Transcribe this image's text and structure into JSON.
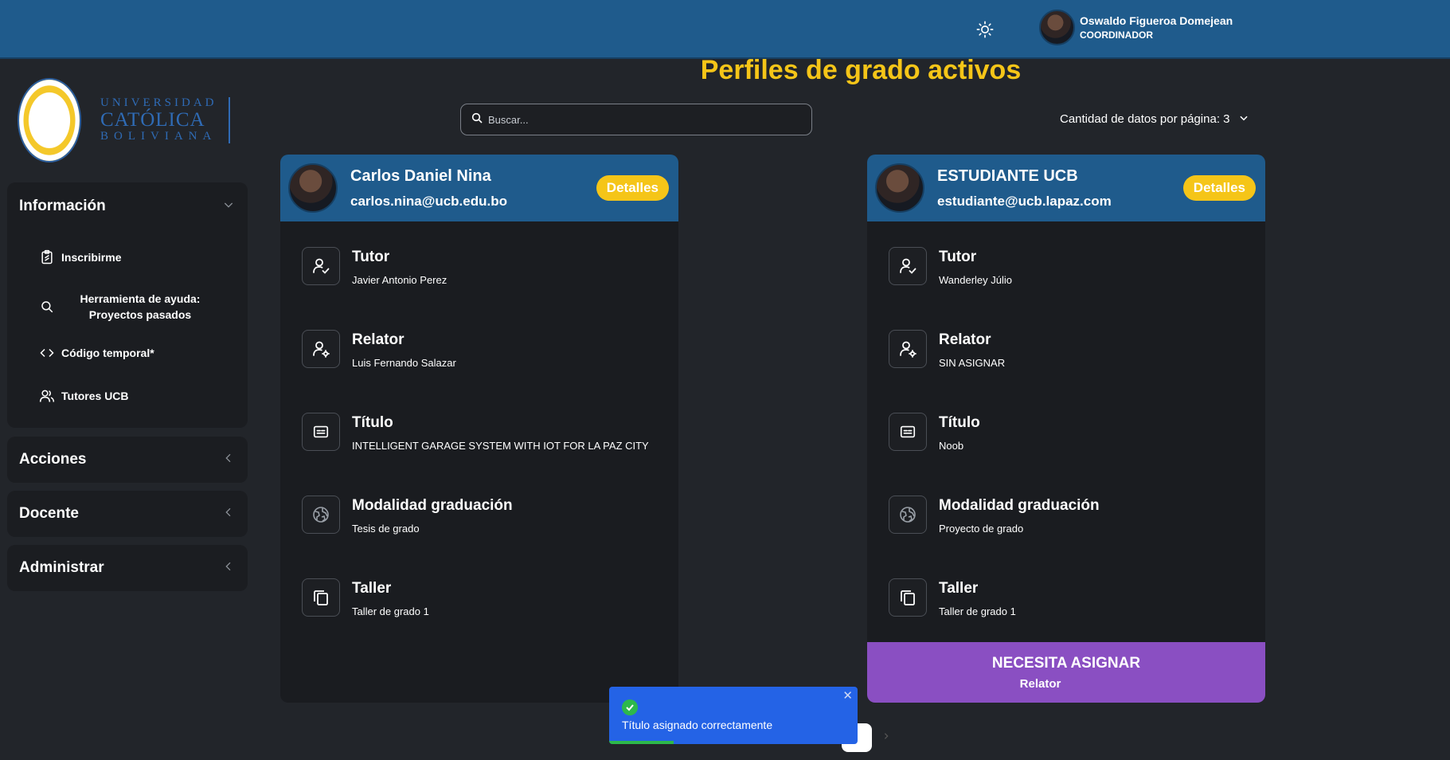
{
  "header": {
    "theme_icon": "sun-icon",
    "user_name": "Oswaldo Figueroa Domejean",
    "user_role": "COORDINADOR"
  },
  "logo": {
    "line1": "UNIVERSIDAD",
    "line2": "CATÓLICA",
    "line3": "BOLIVIANA"
  },
  "sidebar": {
    "informacion": {
      "label": "Información",
      "items": [
        {
          "label": "Inscribirme",
          "icon": "clipboard-icon"
        },
        {
          "label": "Herramienta de ayuda: Proyectos pasados",
          "icon": "search-icon"
        },
        {
          "label": "Código temporal*",
          "icon": "code-icon"
        },
        {
          "label": "Tutores UCB",
          "icon": "users-icon"
        }
      ]
    },
    "acciones": "Acciones",
    "docente": "Docente",
    "administrar": "Administrar"
  },
  "main": {
    "title": "Perfiles de grado activos",
    "search_placeholder": "Buscar...",
    "page_size_label": "Cantidad de datos por página: 3"
  },
  "cards": [
    {
      "name": "Carlos Daniel Nina",
      "email": "carlos.nina@ucb.edu.bo",
      "details_label": "Detalles",
      "fields": [
        {
          "label": "Tutor",
          "value": "Javier Antonio Perez",
          "icon": "user-check-icon"
        },
        {
          "label": "Relator",
          "value": "Luis Fernando Salazar",
          "icon": "user-gear-icon"
        },
        {
          "label": "Título",
          "value": "INTELLIGENT GARAGE SYSTEM WITH IOT FOR LA PAZ CITY",
          "icon": "title-card-icon"
        },
        {
          "label": "Modalidad graduación",
          "value": "Tesis de grado",
          "icon": "globe-icon"
        },
        {
          "label": "Taller",
          "value": "Taller de grado 1",
          "icon": "copy-icon"
        }
      ]
    },
    {
      "name": "ESTUDIANTE UCB",
      "email": "estudiante@ucb.lapaz.com",
      "details_label": "Detalles",
      "fields": [
        {
          "label": "Tutor",
          "value": "Wanderley Júlio",
          "icon": "user-check-icon"
        },
        {
          "label": "Relator",
          "value": "SIN ASIGNAR",
          "icon": "user-gear-icon"
        },
        {
          "label": "Título",
          "value": "Noob",
          "icon": "title-card-icon"
        },
        {
          "label": "Modalidad graduación",
          "value": "Proyecto de grado",
          "icon": "globe-icon"
        },
        {
          "label": "Taller",
          "value": "Taller de grado 1",
          "icon": "copy-icon"
        }
      ],
      "alert": {
        "title": "NECESITA ASIGNAR",
        "subtitle": "Relator"
      }
    }
  ],
  "toast": {
    "message": "Título asignado correctamente",
    "progress": 0.26
  },
  "pagination": {
    "next_icon": "chevron-right-icon"
  },
  "colors": {
    "header": "#1f5b8c",
    "accent_yellow": "#f5c518",
    "alert_purple": "#8a4fc2",
    "toast_blue": "#2463e6",
    "success_green": "#2db84b"
  }
}
